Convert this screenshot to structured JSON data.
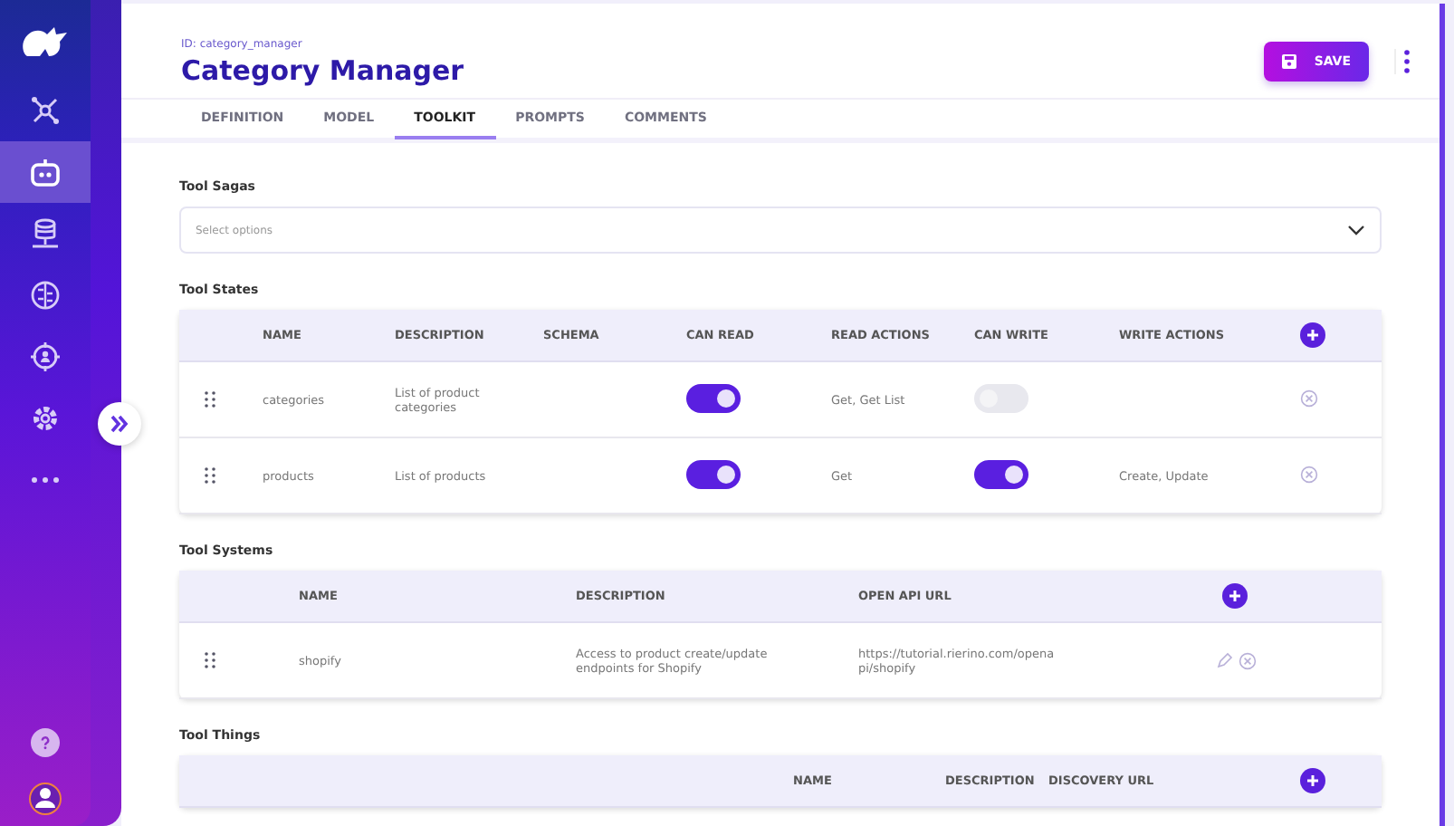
{
  "sidebar": {
    "items": [
      {
        "selected": false
      },
      {
        "selected": true
      },
      {
        "selected": false
      },
      {
        "selected": false
      },
      {
        "selected": false
      },
      {
        "selected": false
      },
      {
        "selected": false
      }
    ]
  },
  "header": {
    "id_label": "ID: category_manager",
    "title": "Category Manager",
    "save": "SAVE"
  },
  "tabs": [
    {
      "label": "DEFINITION",
      "selected": false
    },
    {
      "label": "MODEL",
      "selected": false
    },
    {
      "label": "TOOLKIT",
      "selected": true
    },
    {
      "label": "PROMPTS",
      "selected": false
    },
    {
      "label": "COMMENTS",
      "selected": false
    }
  ],
  "tool_sagas": {
    "title": "Tool Sagas",
    "placeholder": "Select options"
  },
  "tool_states": {
    "title": "Tool States",
    "columns": [
      "NAME",
      "DESCRIPTION",
      "SCHEMA",
      "CAN READ",
      "READ ACTIONS",
      "CAN WRITE",
      "WRITE ACTIONS"
    ],
    "rows": [
      {
        "name": "categories",
        "description": "List of product categories",
        "can_read": true,
        "read_actions": "Get, Get List",
        "can_write": false
      },
      {
        "name": "products",
        "description": "List of products",
        "can_read": true,
        "read_actions": "Get",
        "can_write": true,
        "write_actions": "Create, Update"
      }
    ]
  },
  "tool_systems": {
    "title": "Tool Systems",
    "columns": [
      "NAME",
      "DESCRIPTION",
      "OPEN API URL"
    ],
    "rows": [
      {
        "name": "shopify",
        "description": "Access to product create/update endpoints for Shopify",
        "url": "https://tutorial.rierino.com/openapi/shopify"
      }
    ]
  },
  "tool_things": {
    "title": "Tool Things",
    "columns": [
      "NAME",
      "DESCRIPTION",
      "DISCOVERY URL"
    ]
  }
}
